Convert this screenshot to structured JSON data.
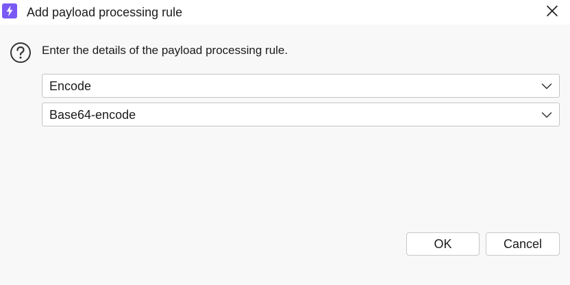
{
  "window": {
    "title": "Add payload processing rule"
  },
  "colors": {
    "app_icon_bg": "#7a5af5",
    "app_icon_fg": "#ffffff",
    "background": "#f8f8f8",
    "titlebar_bg": "#ffffff",
    "border": "#c4c4c4"
  },
  "icons": {
    "app": "lightning-bolt-icon",
    "close": "close-icon",
    "help": "question-circle-icon",
    "dropdown": "chevron-down-icon"
  },
  "dialog": {
    "prompt": "Enter the details of the payload processing rule.",
    "rule_type": {
      "selected": "Encode"
    },
    "rule_option": {
      "selected": "Base64-encode"
    },
    "buttons": {
      "ok": "OK",
      "cancel": "Cancel"
    }
  }
}
